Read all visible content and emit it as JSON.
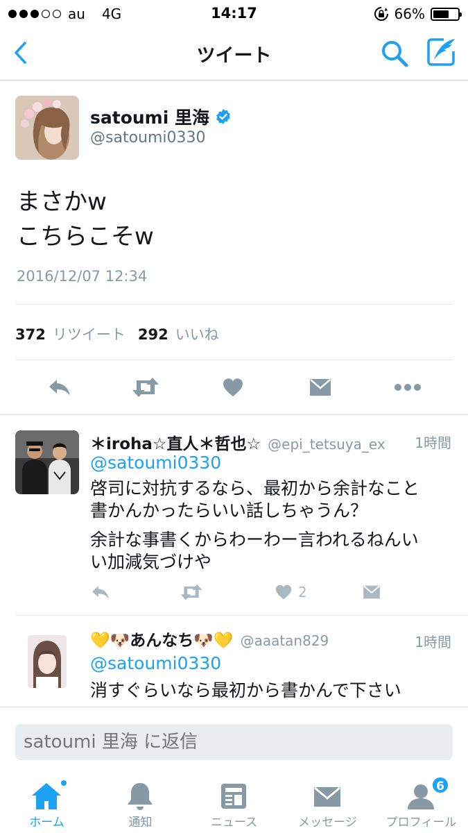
{
  "status_bar": {
    "carrier": "au",
    "network": "4G",
    "time": "14:17",
    "battery": "66%",
    "battery_level": 0.66,
    "signal_bars": 3
  },
  "nav": {
    "title": "ツイート",
    "back_icon": "chevron-left-icon",
    "search_icon": "search-icon",
    "compose_icon": "compose-tweet-icon"
  },
  "tweet": {
    "user_name": "satoumi 里海",
    "handle": "@satoumi0330",
    "verified": true,
    "text_lines": [
      "まさかw",
      "こちらこそw"
    ],
    "date": "2016/12/07 12:34",
    "retweet_count": "372",
    "retweet_label": "リツイート",
    "like_count": "292",
    "like_label": "いいね"
  },
  "replies": [
    {
      "name": "＊iroha☆直人＊哲也☆",
      "handle": "@epi_tetsuya_ex",
      "time": "1時間",
      "mention": "@satoumi0330",
      "paragraphs": [
        [
          "啓司に対抗するなら、最初から余計なこと",
          "書かんかったらいい話しちゃうん？"
        ],
        [
          "余計な事書くからわーわー言われるねんい",
          "い加減気づけや"
        ]
      ],
      "like_count": "2"
    },
    {
      "name": "💛🐶あんなち🐶💛",
      "handle": "@aaatan829",
      "time": "1時間",
      "mention": "@satoumi0330",
      "paragraphs": [
        [
          "消すぐらいなら最初から書かんで下さい"
        ]
      ]
    }
  ],
  "reply_input": {
    "placeholder": "satoumi 里海 に返信"
  },
  "tabs": [
    {
      "label": "ホーム",
      "icon": "home-icon",
      "active": true
    },
    {
      "label": "通知",
      "icon": "bell-icon",
      "active": false
    },
    {
      "label": "ニュース",
      "icon": "news-icon",
      "active": false
    },
    {
      "label": "メッセージ",
      "icon": "mail-icon",
      "active": false
    },
    {
      "label": "プロフィール",
      "icon": "profile-icon",
      "active": false,
      "badge": "6"
    }
  ],
  "colors": {
    "accent": "#1da1f2",
    "muted": "#8899a6",
    "icon_grey": "#aab8c2"
  }
}
